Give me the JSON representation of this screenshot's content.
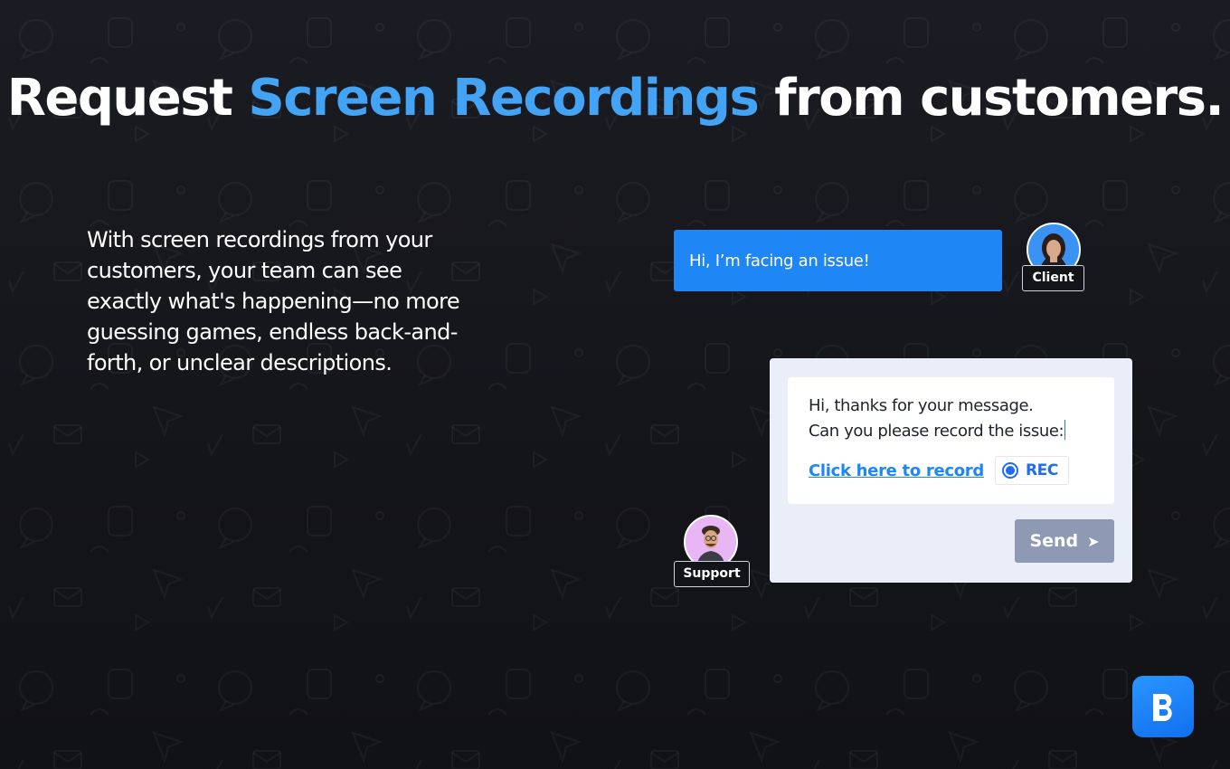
{
  "headline": {
    "part1": "Request ",
    "highlight": "Screen Recordings",
    "part2": " from customers."
  },
  "intro": {
    "text": "With screen recordings from your customers, your team can see exactly what's happening—no more guessing games, endless back-and-forth, or unclear descriptions."
  },
  "client": {
    "message": "Hi, I’m facing an issue!",
    "tag": "Client"
  },
  "support": {
    "tag": "Support",
    "reply_line1": "Hi, thanks for your message.",
    "reply_line2": "Can you please record the issue:",
    "record_link": "Click here to record",
    "rec_label": "REC",
    "send_label": "Send",
    "send_icon": "➤"
  },
  "logo": {
    "name": "B-logo-icon"
  },
  "colors": {
    "accent": "#43a3f4",
    "bubble": "#1f86f5",
    "send": "#8e9ab3",
    "panel": "#e9eef8"
  }
}
